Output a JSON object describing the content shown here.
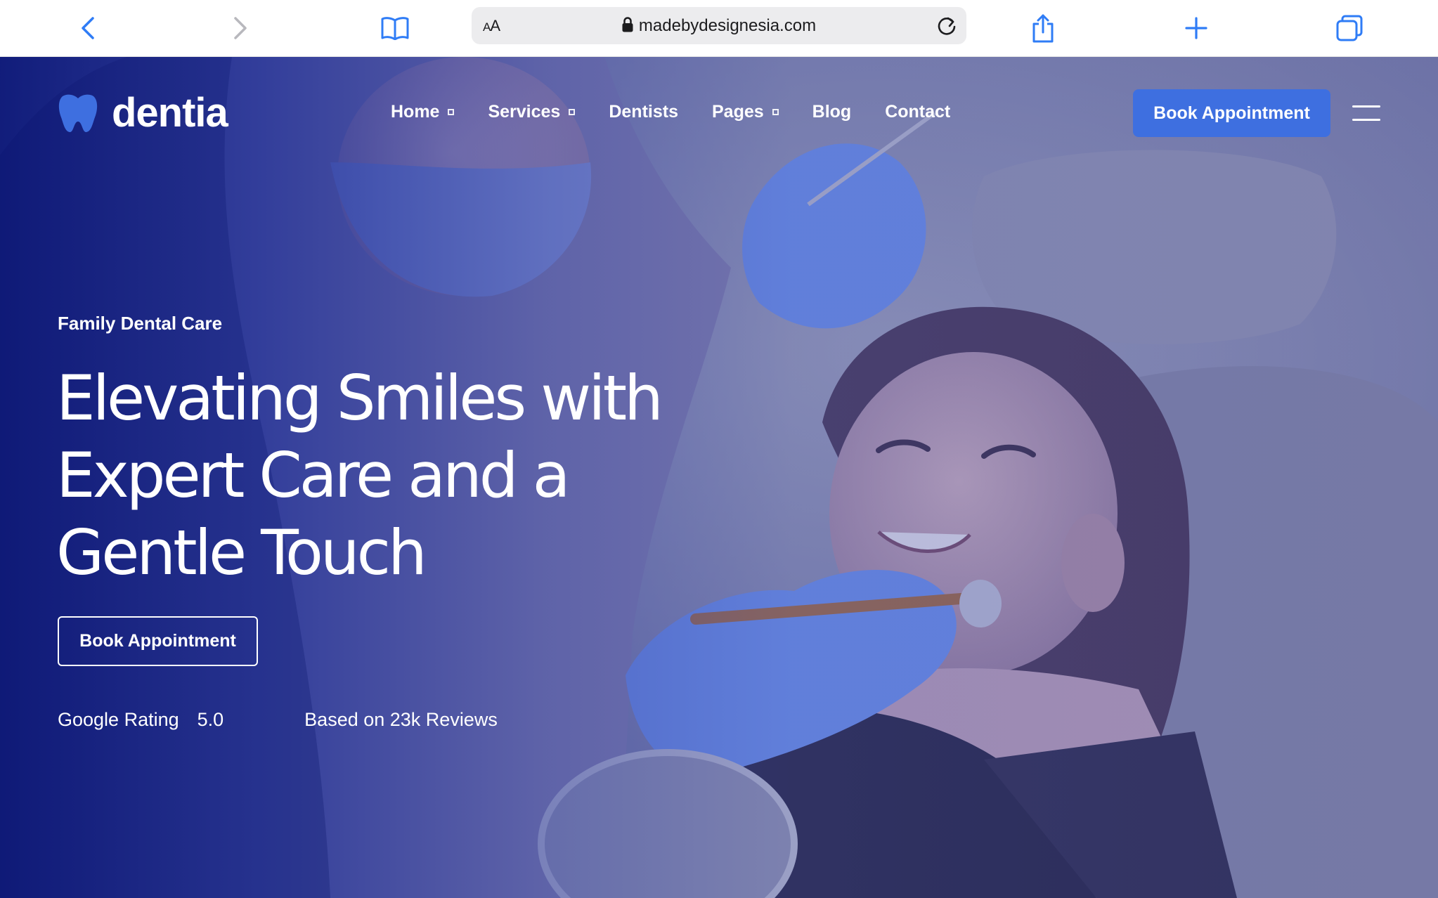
{
  "browser": {
    "url": "madebydesignesia.com",
    "reader_label_big": "A",
    "reader_label_small": "A",
    "icons": [
      "back-icon",
      "forward-icon",
      "bookmarks-icon",
      "lock-icon",
      "reload-icon",
      "share-icon",
      "new-tab-icon",
      "tabs-icon"
    ]
  },
  "site": {
    "logo_text": "dentia",
    "nav": {
      "items": [
        {
          "label": "Home",
          "has_dropdown": true
        },
        {
          "label": "Services",
          "has_dropdown": true
        },
        {
          "label": "Dentists",
          "has_dropdown": false
        },
        {
          "label": "Pages",
          "has_dropdown": true
        },
        {
          "label": "Blog",
          "has_dropdown": false
        },
        {
          "label": "Contact",
          "has_dropdown": false
        }
      ],
      "cta_label": "Book Appointment"
    },
    "hero": {
      "eyebrow": "Family Dental Care",
      "headline_line1": "Elevating Smiles with",
      "headline_line2": "Expert Care and a",
      "headline_line3": "Gentle Touch",
      "cta_label": "Book Appointment",
      "rating_label": "Google Rating",
      "rating_value": "5.0",
      "reviews_text": "Based on 23k Reviews"
    }
  },
  "colors": {
    "accent": "#3e6fe0",
    "overlay_blue": "#0a1678",
    "browser_icon_blue": "#2f7cf6",
    "toolbar_bg": "#ffffff"
  }
}
